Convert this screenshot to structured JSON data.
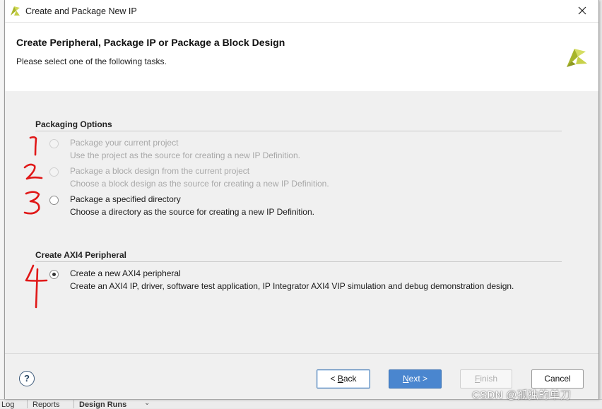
{
  "window": {
    "title": "Create and Package New IP",
    "app_icon": "vivado-logo-icon",
    "close_icon": "close-icon"
  },
  "header": {
    "heading": "Create Peripheral, Package IP or Package a Block Design",
    "subheading": "Please select one of the following tasks.",
    "logo_icon": "xilinx-logo-icon"
  },
  "sections": {
    "packaging": {
      "title": "Packaging Options",
      "options": [
        {
          "label": "Package your current project",
          "desc": "Use the project as the source for creating a new IP Definition.",
          "enabled": false,
          "selected": false
        },
        {
          "label": "Package a block design from the current project",
          "desc": "Choose a block design as the source for creating a new IP Definition.",
          "enabled": false,
          "selected": false
        },
        {
          "label": "Package a specified directory",
          "desc": "Choose a directory as the source for creating a new IP Definition.",
          "enabled": true,
          "selected": false
        }
      ]
    },
    "axi": {
      "title": "Create AXI4 Peripheral",
      "options": [
        {
          "label": "Create a new AXI4 peripheral",
          "desc": "Create an AXI4 IP, driver, software test application, IP Integrator AXI4 VIP simulation and debug demonstration design.",
          "enabled": true,
          "selected": true
        }
      ]
    }
  },
  "annotations": [
    "1",
    "2",
    "3",
    "4"
  ],
  "footer": {
    "help": "?",
    "back": {
      "prefix": "< ",
      "mnemonic": "B",
      "rest": "ack"
    },
    "next": {
      "mnemonic": "N",
      "rest": "ext >"
    },
    "finish": {
      "mnemonic": "F",
      "rest": "inish"
    },
    "cancel": "Cancel"
  },
  "background": {
    "bottom_tabs": [
      "Log",
      "Reports",
      "Design Runs"
    ]
  },
  "watermark": "CSDN @孤独的单刀",
  "colors": {
    "accent": "#4a86cf",
    "annotation": "#e01818",
    "logo": "#b7c43a"
  }
}
